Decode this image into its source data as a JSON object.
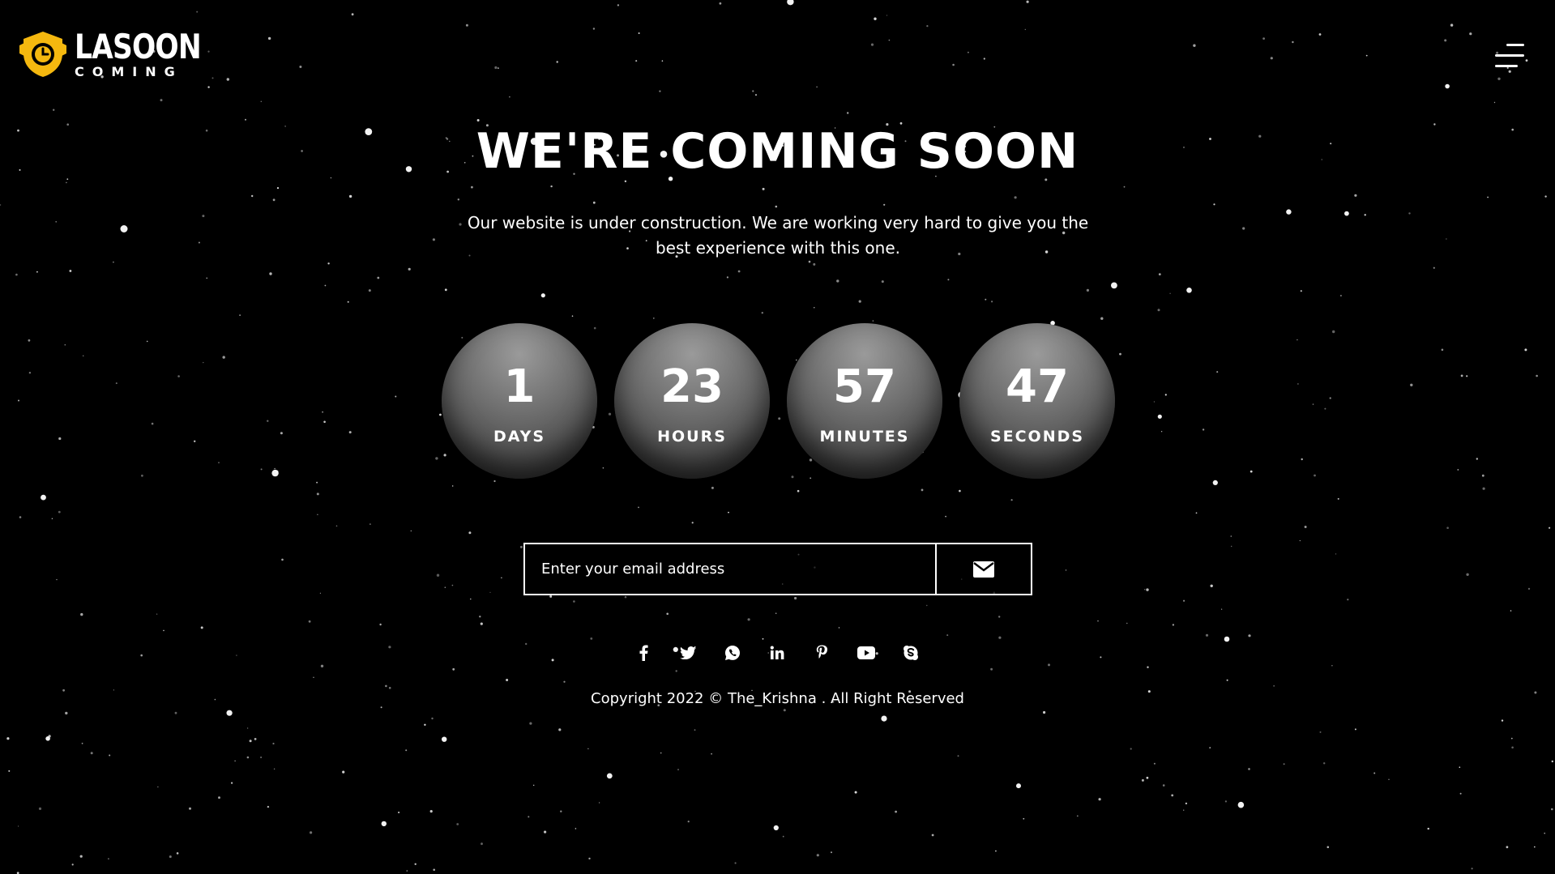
{
  "brand": {
    "name": "LASOON",
    "tagline": "COMING",
    "logo_icon": "shield-clock-icon",
    "accent_color": "#F5B80F"
  },
  "header": {
    "menu_icon": "hamburger-menu-icon"
  },
  "hero": {
    "title": "WE'RE COMING SOON",
    "description": "Our website is under construction. We are working very hard to give you the best experience with this one."
  },
  "countdown": [
    {
      "value": "1",
      "label": "DAYS"
    },
    {
      "value": "23",
      "label": "HOURS"
    },
    {
      "value": "57",
      "label": "MINUTES"
    },
    {
      "value": "47",
      "label": "SECONDS"
    }
  ],
  "subscribe": {
    "placeholder": "Enter your email address",
    "value": "",
    "submit_icon": "envelope-icon"
  },
  "social": [
    {
      "name": "facebook",
      "icon": "facebook-icon"
    },
    {
      "name": "twitter",
      "icon": "twitter-icon"
    },
    {
      "name": "whatsapp",
      "icon": "whatsapp-icon"
    },
    {
      "name": "linkedin",
      "icon": "linkedin-icon"
    },
    {
      "name": "pinterest",
      "icon": "pinterest-icon"
    },
    {
      "name": "youtube",
      "icon": "youtube-icon"
    },
    {
      "name": "skype",
      "icon": "skype-icon"
    }
  ],
  "footer": {
    "copyright": "Copyright 2022 © The_Krishna . All Right Reserved"
  },
  "colors": {
    "background": "#000000",
    "text": "#FFFFFF",
    "circle": "#6F6F6F"
  }
}
